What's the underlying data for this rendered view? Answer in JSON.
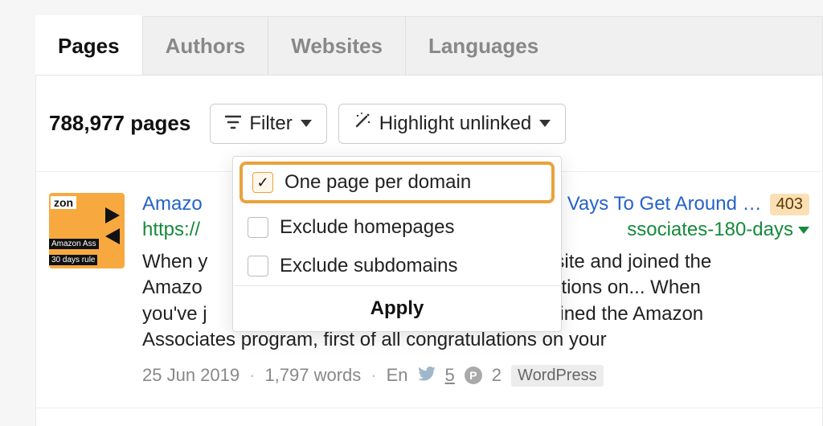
{
  "tabs": {
    "pages": "Pages",
    "authors": "Authors",
    "websites": "Websites",
    "languages": "Languages"
  },
  "toolbar": {
    "count": "788,977 pages",
    "filter_label": "Filter",
    "highlight_label": "Highlight unlinked"
  },
  "filter_popover": {
    "one_per_domain": "One page per domain",
    "exclude_homepages": "Exclude homepages",
    "exclude_subdomains": "Exclude subdomains",
    "apply": "Apply",
    "one_per_domain_checked": true,
    "exclude_homepages_checked": false,
    "exclude_subdomains_checked": false
  },
  "result": {
    "title_prefix": "Amazo",
    "title_suffix": "Vays To Get Around …",
    "badge": "403",
    "url_prefix": "https://",
    "url_suffix": "ssociates-180-days",
    "snippet_prefix": "When y",
    "snippet_mid1": "vebsite and joined the",
    "snippet_line2a": "Amazo",
    "snippet_line2b": "gratulations on... When",
    "snippet_line3a": "you've j",
    "snippet_line3b": "and joined the Amazon",
    "snippet_line4": "Associates program, first of all congratulations on your",
    "date": "25 Jun 2019",
    "words": "1,797 words",
    "lang": "En",
    "twitter_count": "5",
    "pinterest_count": "2",
    "platform": "WordPress"
  },
  "thumb": {
    "zon": "zon",
    "assoc": "Amazon Ass",
    "rule": "30 days rule"
  }
}
